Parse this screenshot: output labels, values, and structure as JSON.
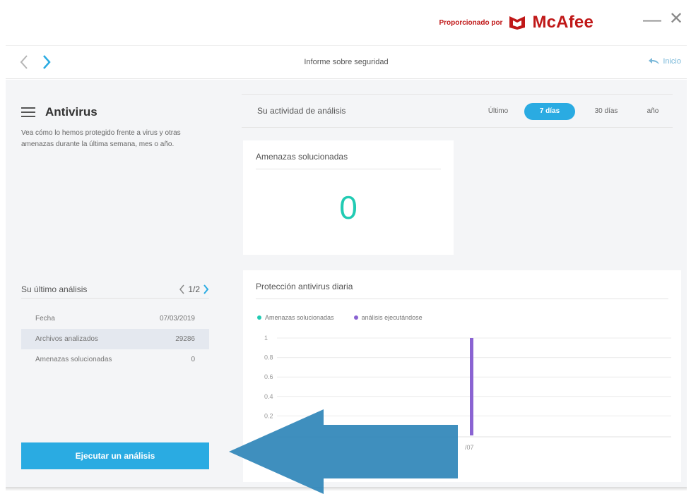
{
  "header": {
    "powered_by": "Proporcionado por",
    "brand": "McAfee",
    "brand_color": "#c01818",
    "minimize_icon": "minimize-icon",
    "close_icon": "close-icon"
  },
  "nav": {
    "title": "Informe sobre seguridad",
    "home_label": "Inicio",
    "back_icon": "chevron-left-icon",
    "forward_icon": "chevron-right-icon"
  },
  "left": {
    "title": "Antivirus",
    "description": "Vea cómo lo hemos protegido frente a virus y otras amenazas durante la última semana, mes o año.",
    "last_scan": {
      "title": "Su último análisis",
      "pager": "1/2",
      "rows": [
        {
          "label": "Fecha",
          "value": "07/03/2019"
        },
        {
          "label": "Archivos analizados",
          "value": "29286"
        },
        {
          "label": "Amenazas solucionadas",
          "value": "0"
        }
      ]
    },
    "run_button": "Ejecutar un análisis"
  },
  "activity": {
    "title": "Su actividad de análisis",
    "periods": [
      "Último",
      "7 días",
      "30 días",
      "año"
    ],
    "selected_period": "7 días"
  },
  "threats_card": {
    "title": "Amenazas solucionadas",
    "value": "0"
  },
  "daily_card": {
    "title": "Protección antivirus diaria",
    "legend": [
      {
        "label": "Amenazas solucionadas",
        "color": "#21cbb3"
      },
      {
        "label": "análisis ejecutándose",
        "color": "#8a63d2"
      }
    ],
    "y_ticks": [
      "1",
      "0.8",
      "0.6",
      "0.4",
      "0.2"
    ],
    "x_label_visible": "/07"
  },
  "chart_data": {
    "type": "bar",
    "title": "Protección antivirus diaria",
    "ylim": [
      0,
      1
    ],
    "y_ticks": [
      1,
      0.8,
      0.6,
      0.4,
      0.2
    ],
    "categories": [
      "/07"
    ],
    "series": [
      {
        "name": "Amenazas solucionadas",
        "color": "#21cbb3",
        "values": [
          0
        ]
      },
      {
        "name": "análisis ejecutándose",
        "color": "#8a63d2",
        "values": [
          1
        ]
      }
    ],
    "grid": true,
    "legend": "top-left"
  },
  "colors": {
    "accent": "#2aabe2",
    "teal": "#21cbb3",
    "purple": "#8a63d2",
    "arrow": "#2f86b8"
  }
}
